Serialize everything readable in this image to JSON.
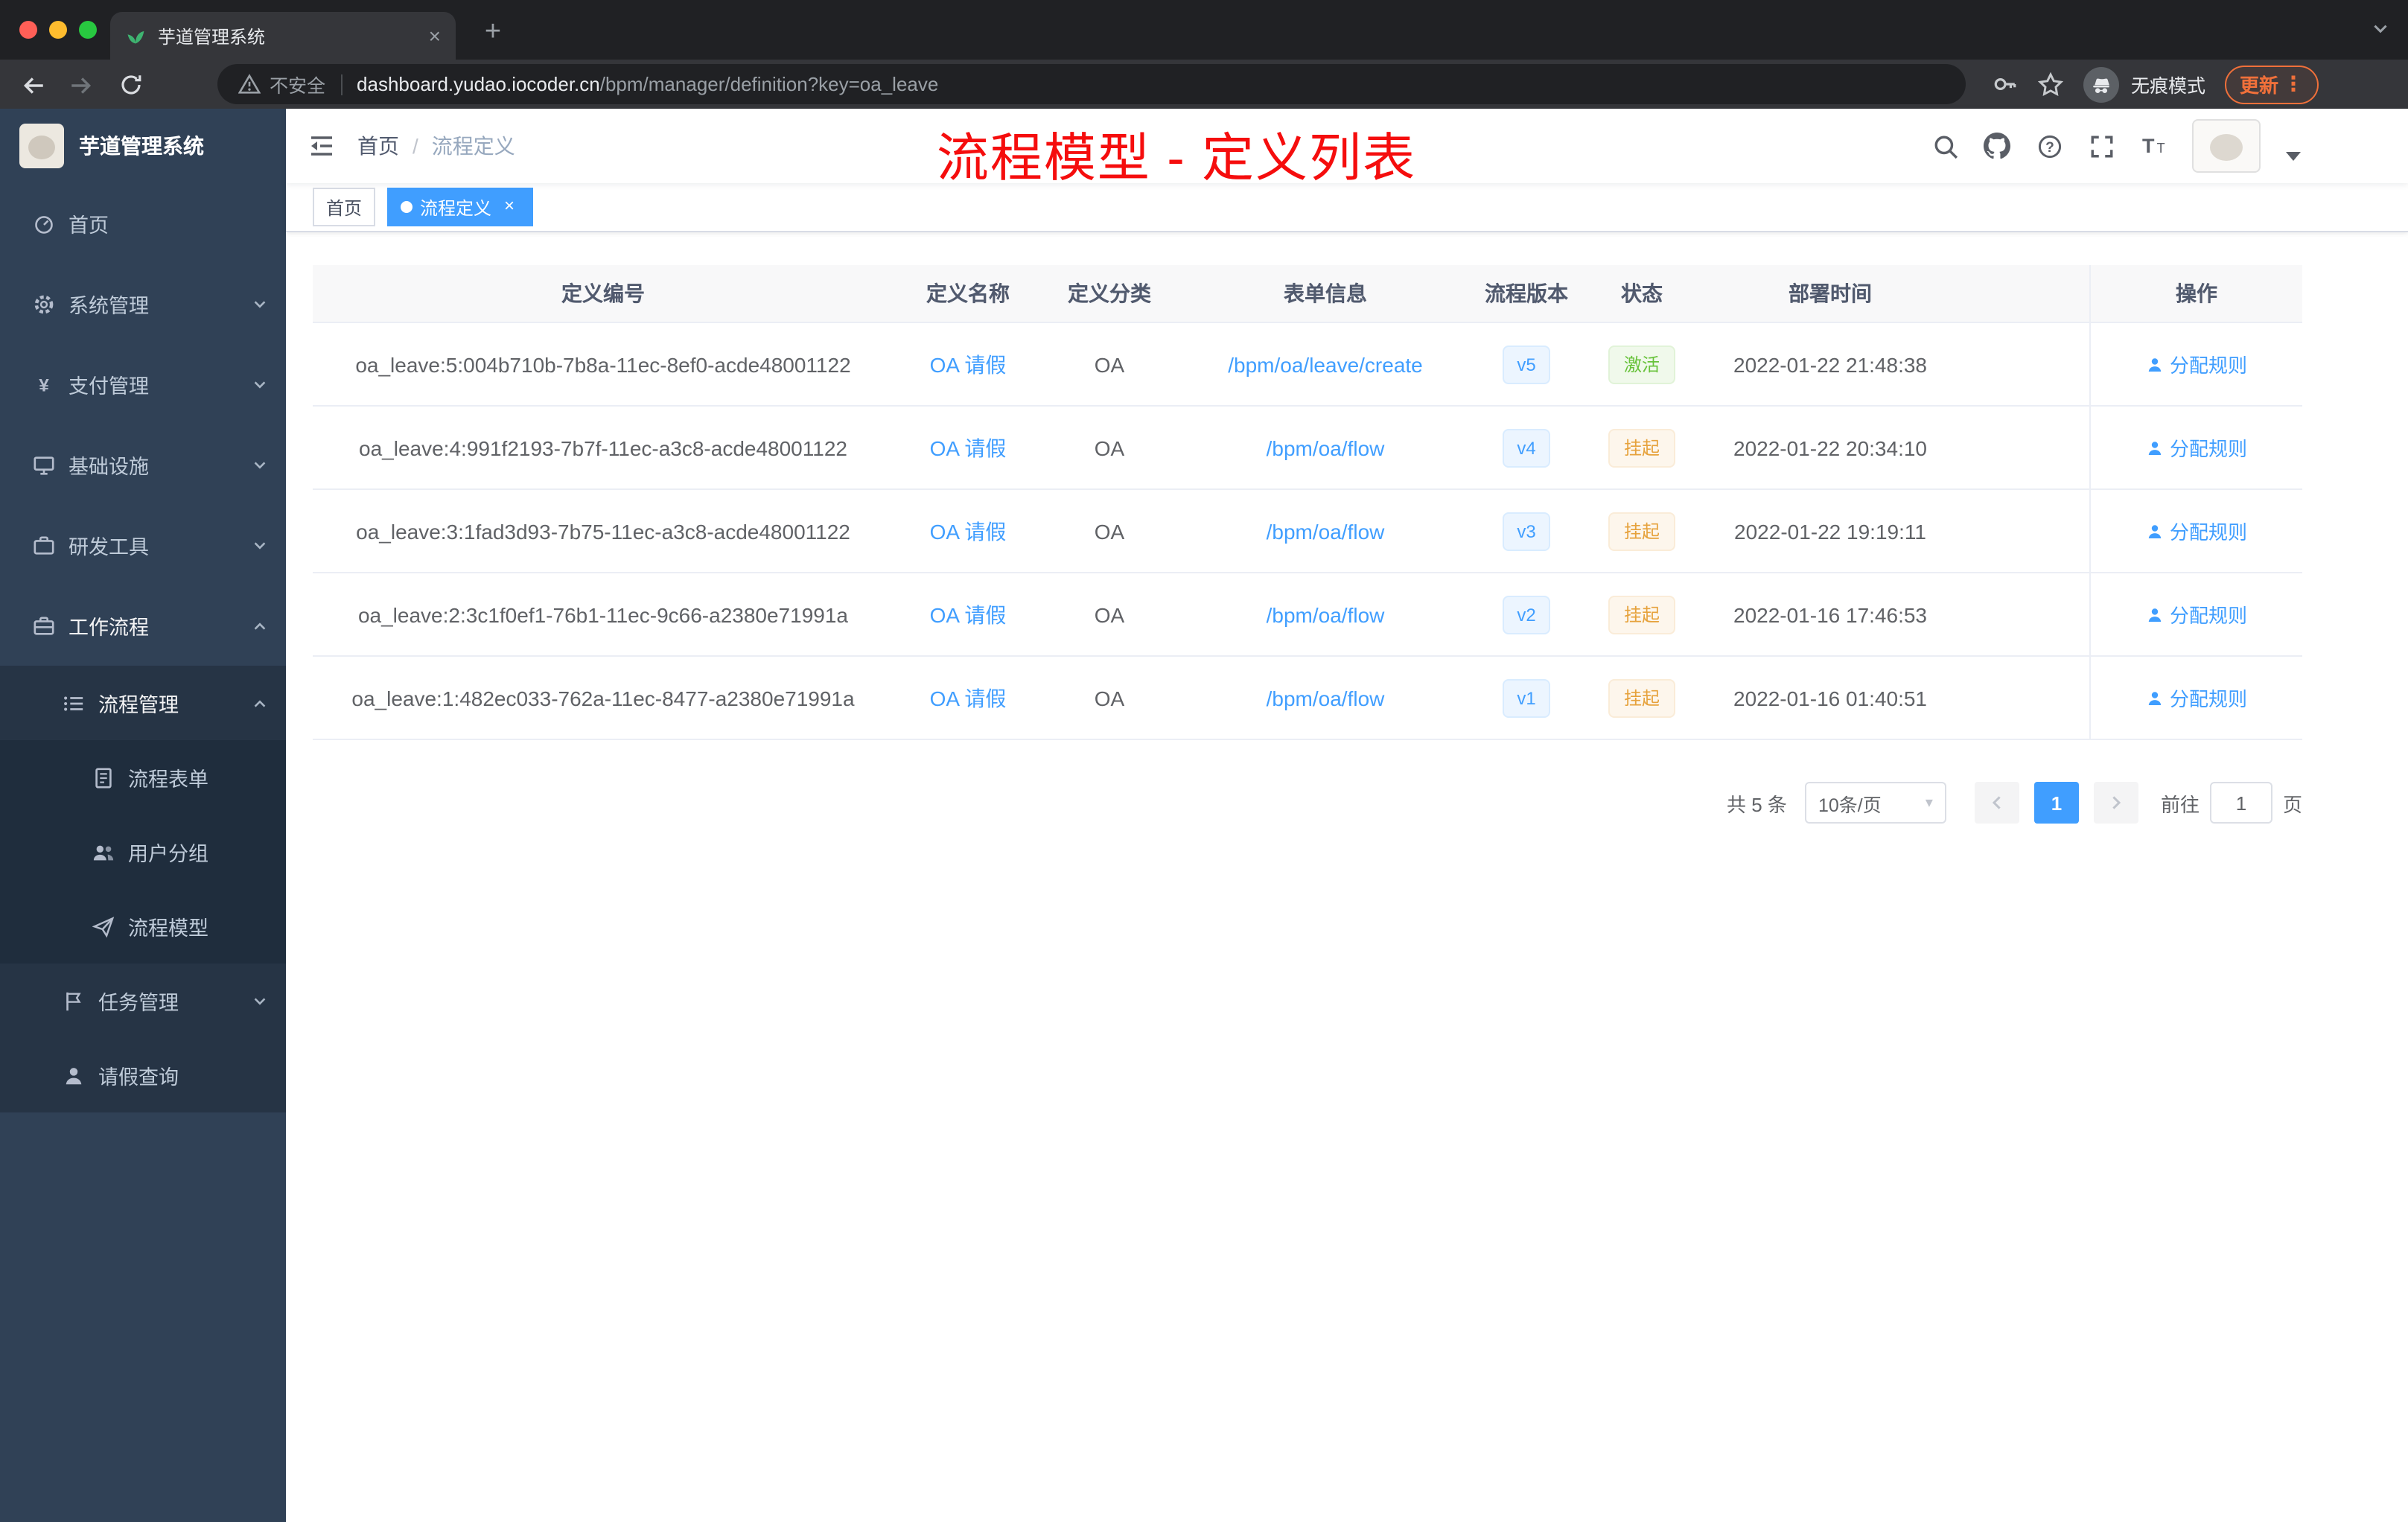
{
  "browser": {
    "tab_title": "芋道管理系统",
    "tab_close": "×",
    "new_tab": "+",
    "security_label": "不安全",
    "url_domain": "dashboard.yudao.iocoder.cn",
    "url_path": "/bpm/manager/definition?key=oa_leave",
    "incognito_label": "无痕模式",
    "update_label": "更新"
  },
  "app": {
    "logo_title": "芋道管理系统",
    "breadcrumb": {
      "home": "首页",
      "separator": "/",
      "current": "流程定义"
    },
    "annotation": "流程模型 - 定义列表",
    "tags": [
      {
        "label": "首页",
        "active": false
      },
      {
        "label": "流程定义",
        "active": true
      }
    ]
  },
  "sidebar": {
    "items": [
      {
        "label": "首页",
        "icon": "dashboard-icon",
        "level": 1
      },
      {
        "label": "系统管理",
        "icon": "gear-icon",
        "level": 1,
        "chevron": "down"
      },
      {
        "label": "支付管理",
        "icon": "payment-icon",
        "level": 1,
        "chevron": "down"
      },
      {
        "label": "基础设施",
        "icon": "infrastructure-icon",
        "level": 1,
        "chevron": "down"
      },
      {
        "label": "研发工具",
        "icon": "devtools-icon",
        "level": 1,
        "chevron": "down"
      },
      {
        "label": "工作流程",
        "icon": "workflow-icon",
        "level": 1,
        "chevron": "up",
        "expanded": true
      },
      {
        "label": "流程管理",
        "icon": "process-icon",
        "level": 2,
        "chevron": "up",
        "expanded": true
      },
      {
        "label": "流程表单",
        "icon": "form-icon",
        "level": 3
      },
      {
        "label": "用户分组",
        "icon": "usergroup-icon",
        "level": 3
      },
      {
        "label": "流程模型",
        "icon": "model-icon",
        "level": 3
      },
      {
        "label": "任务管理",
        "icon": "task-icon",
        "level": 2,
        "chevron": "down"
      },
      {
        "label": "请假查询",
        "icon": "person-icon",
        "level": 2
      }
    ]
  },
  "table": {
    "columns": [
      "定义编号",
      "定义名称",
      "定义分类",
      "表单信息",
      "流程版本",
      "状态",
      "部署时间",
      "操作"
    ],
    "rows": [
      {
        "id": "oa_leave:5:004b710b-7b8a-11ec-8ef0-acde48001122",
        "name": "OA 请假",
        "category": "OA",
        "form": "/bpm/oa/leave/create",
        "version": "v5",
        "status": "激活",
        "status_type": "success",
        "time": "2022-01-22 21:48:38",
        "action": "分配规则"
      },
      {
        "id": "oa_leave:4:991f2193-7b7f-11ec-a3c8-acde48001122",
        "name": "OA 请假",
        "category": "OA",
        "form": "/bpm/oa/flow",
        "version": "v4",
        "status": "挂起",
        "status_type": "warning",
        "time": "2022-01-22 20:34:10",
        "action": "分配规则"
      },
      {
        "id": "oa_leave:3:1fad3d93-7b75-11ec-a3c8-acde48001122",
        "name": "OA 请假",
        "category": "OA",
        "form": "/bpm/oa/flow",
        "version": "v3",
        "status": "挂起",
        "status_type": "warning",
        "time": "2022-01-22 19:19:11",
        "action": "分配规则"
      },
      {
        "id": "oa_leave:2:3c1f0ef1-76b1-11ec-9c66-a2380e71991a",
        "name": "OA 请假",
        "category": "OA",
        "form": "/bpm/oa/flow",
        "version": "v2",
        "status": "挂起",
        "status_type": "warning",
        "time": "2022-01-16 17:46:53",
        "action": "分配规则"
      },
      {
        "id": "oa_leave:1:482ec033-762a-11ec-8477-a2380e71991a",
        "name": "OA 请假",
        "category": "OA",
        "form": "/bpm/oa/flow",
        "version": "v1",
        "status": "挂起",
        "status_type": "warning",
        "time": "2022-01-16 01:40:51",
        "action": "分配规则"
      }
    ]
  },
  "pagination": {
    "total": "共 5 条",
    "page_size": "10条/页",
    "current_page": "1",
    "goto_label": "前往",
    "goto_value": "1",
    "page_unit": "页"
  }
}
